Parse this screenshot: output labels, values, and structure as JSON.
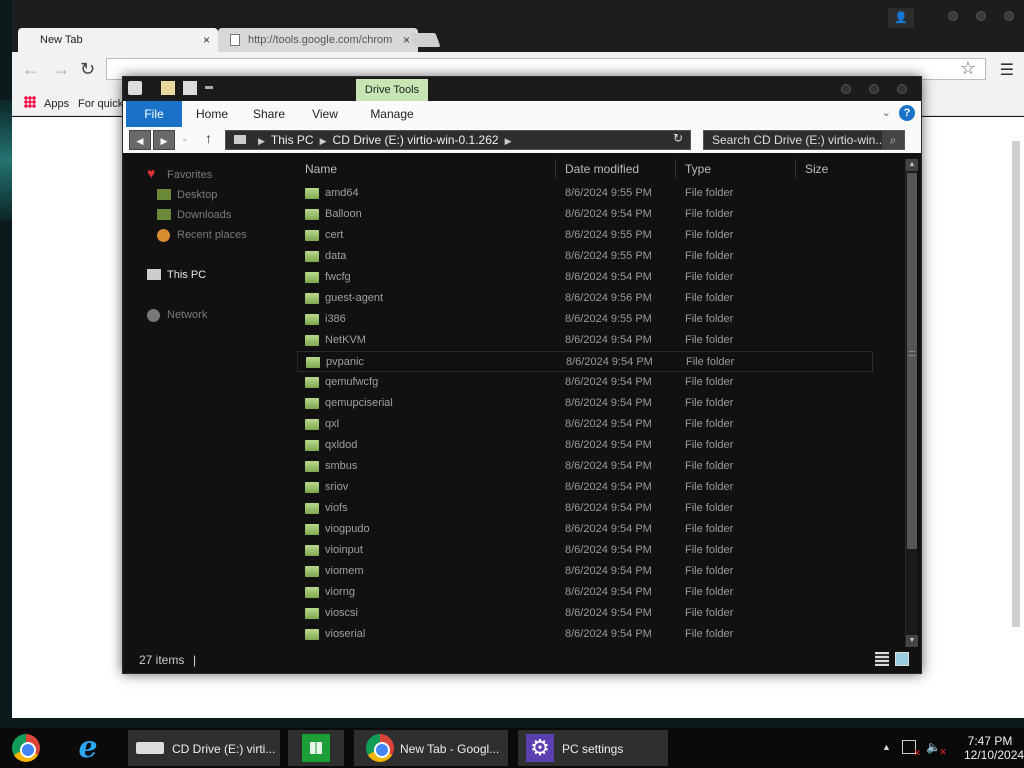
{
  "browser": {
    "tabs": [
      {
        "label": "New Tab"
      },
      {
        "label": "http://tools.google.com/chrom"
      }
    ],
    "close_glyph": "×",
    "new_tab_label": "",
    "bookmarks": {
      "apps": "Apps",
      "quick": "For quick"
    }
  },
  "explorer": {
    "contextual_tab": "Drive Tools",
    "ribbon_tabs": [
      "File",
      "Home",
      "Share",
      "View",
      "Manage"
    ],
    "breadcrumb": [
      "This PC",
      "CD Drive (E:) virtio-win-0.1.262"
    ],
    "search_placeholder": "Search CD Drive (E:) virtio-win...",
    "nav": {
      "favorites": "Favorites",
      "desktop": "Desktop",
      "downloads": "Downloads",
      "recent": "Recent places",
      "this_pc": "This PC",
      "network": "Network"
    },
    "columns": {
      "name": "Name",
      "date": "Date modified",
      "type": "Type",
      "size": "Size"
    },
    "files": [
      {
        "name": "amd64",
        "date": "8/6/2024 9:55 PM",
        "type": "File folder"
      },
      {
        "name": "Balloon",
        "date": "8/6/2024 9:54 PM",
        "type": "File folder"
      },
      {
        "name": "cert",
        "date": "8/6/2024 9:55 PM",
        "type": "File folder"
      },
      {
        "name": "data",
        "date": "8/6/2024 9:55 PM",
        "type": "File folder"
      },
      {
        "name": "fwcfg",
        "date": "8/6/2024 9:54 PM",
        "type": "File folder"
      },
      {
        "name": "guest-agent",
        "date": "8/6/2024 9:56 PM",
        "type": "File folder"
      },
      {
        "name": "i386",
        "date": "8/6/2024 9:55 PM",
        "type": "File folder"
      },
      {
        "name": "NetKVM",
        "date": "8/6/2024 9:54 PM",
        "type": "File folder"
      },
      {
        "name": "pvpanic",
        "date": "8/6/2024 9:54 PM",
        "type": "File folder"
      },
      {
        "name": "qemufwcfg",
        "date": "8/6/2024 9:54 PM",
        "type": "File folder"
      },
      {
        "name": "qemupciserial",
        "date": "8/6/2024 9:54 PM",
        "type": "File folder"
      },
      {
        "name": "qxl",
        "date": "8/6/2024 9:54 PM",
        "type": "File folder"
      },
      {
        "name": "qxldod",
        "date": "8/6/2024 9:54 PM",
        "type": "File folder"
      },
      {
        "name": "smbus",
        "date": "8/6/2024 9:54 PM",
        "type": "File folder"
      },
      {
        "name": "sriov",
        "date": "8/6/2024 9:54 PM",
        "type": "File folder"
      },
      {
        "name": "viofs",
        "date": "8/6/2024 9:54 PM",
        "type": "File folder"
      },
      {
        "name": "viogpudo",
        "date": "8/6/2024 9:54 PM",
        "type": "File folder"
      },
      {
        "name": "vioinput",
        "date": "8/6/2024 9:54 PM",
        "type": "File folder"
      },
      {
        "name": "viomem",
        "date": "8/6/2024 9:54 PM",
        "type": "File folder"
      },
      {
        "name": "viorng",
        "date": "8/6/2024 9:54 PM",
        "type": "File folder"
      },
      {
        "name": "vioscsi",
        "date": "8/6/2024 9:54 PM",
        "type": "File folder"
      },
      {
        "name": "vioserial",
        "date": "8/6/2024 9:54 PM",
        "type": "File folder"
      }
    ],
    "status_count": "27 items"
  },
  "taskbar": {
    "items": [
      {
        "label": "CD Drive (E:) virti..."
      },
      {
        "label": "New Tab - Googl..."
      },
      {
        "label": "PC settings"
      }
    ],
    "time": "7:47 PM",
    "date": "12/10/2024"
  },
  "colors": {
    "accent": "#1a73c9",
    "drive_tools": "#c8e6b4",
    "folder": "#9cc56a"
  }
}
